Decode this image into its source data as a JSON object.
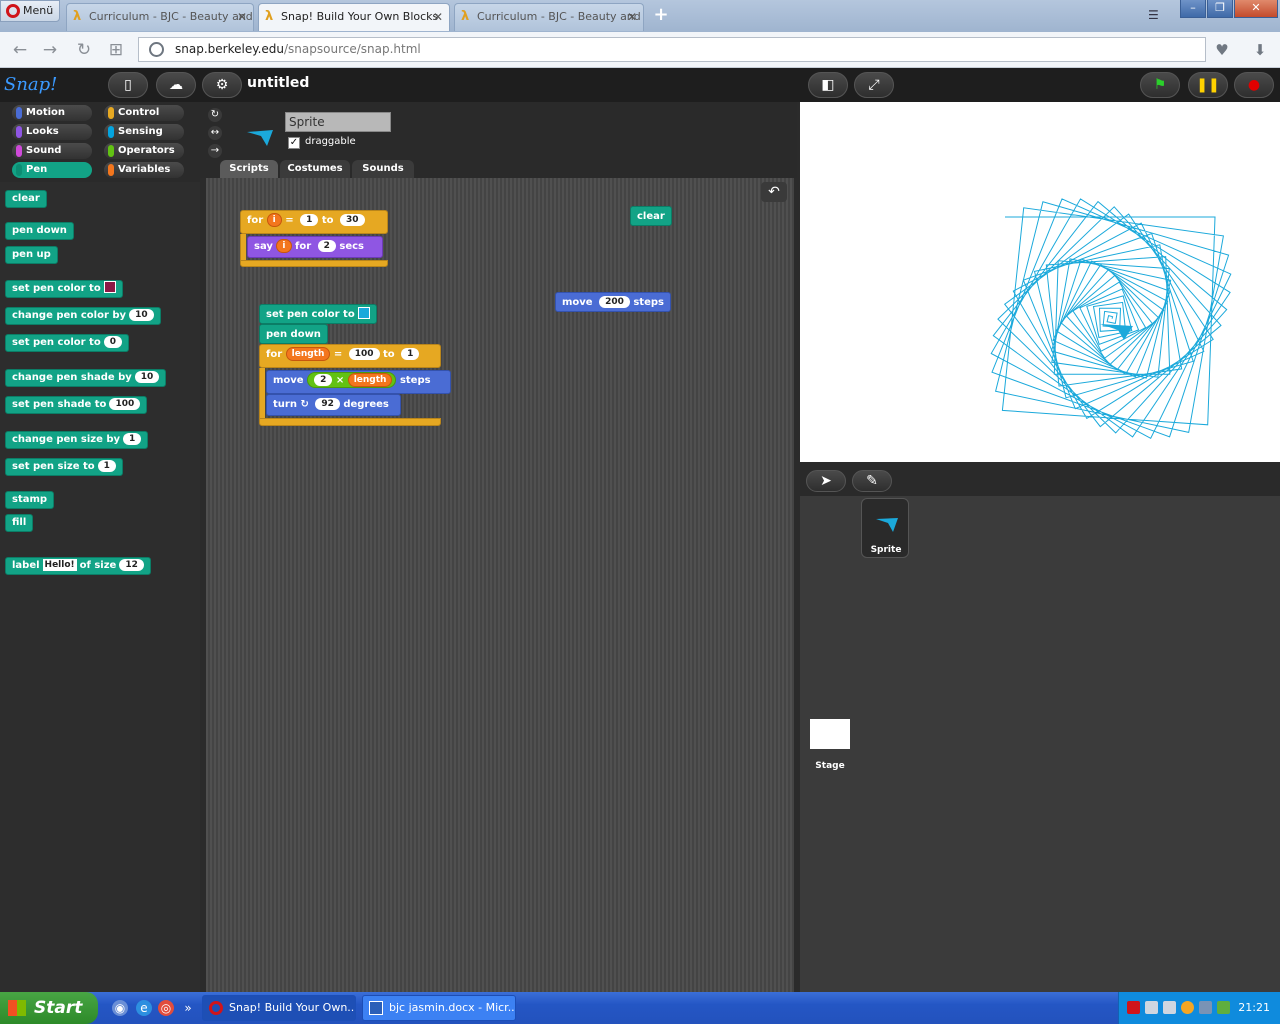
{
  "browser": {
    "menu_label": "Menü",
    "tabs": [
      {
        "title": "Curriculum - BJC - Beauty and Joy of Computing"
      },
      {
        "title": "Snap! Build Your Own Blocks"
      },
      {
        "title": "Curriculum - BJC - Beauty and Joy of Computing"
      }
    ],
    "url_domain": "snap.berkeley.edu",
    "url_path": "/snapsource/snap.html"
  },
  "snap": {
    "logo": "Snap!",
    "project_name": "untitled",
    "categories": [
      "Motion",
      "Control",
      "Looks",
      "Sensing",
      "Sound",
      "Operators",
      "Pen",
      "Variables"
    ],
    "selected_category": "Pen",
    "sprite_name": "Sprite",
    "draggable_label": "draggable",
    "tabs": [
      "Scripts",
      "Costumes",
      "Sounds"
    ],
    "active_tab": "Scripts",
    "palette": {
      "clear": "clear",
      "pen_down": "pen down",
      "pen_up": "pen up",
      "set_pen_color_to": "set pen color to",
      "change_pen_color_by": "change pen color by",
      "change_pen_color_by_val": "10",
      "set_pen_color_to_num": "set pen color to",
      "set_pen_color_to_num_val": "0",
      "change_pen_shade_by": "change pen shade by",
      "change_pen_shade_by_val": "10",
      "set_pen_shade_to": "set pen shade to",
      "set_pen_shade_to_val": "100",
      "change_pen_size_by": "change pen size by",
      "change_pen_size_by_val": "1",
      "set_pen_size_to": "set pen size to",
      "set_pen_size_to_val": "1",
      "stamp": "stamp",
      "fill": "fill",
      "label_pre": "label",
      "label_text": "Hello!",
      "label_of_size": "of size",
      "label_size": "12"
    },
    "script1": {
      "for": "for",
      "var": "i",
      "eq": "=",
      "from": "1",
      "to": "to",
      "to_val": "30",
      "say": "say",
      "say_var": "i",
      "for2": "for",
      "secs_val": "2",
      "secs": "secs"
    },
    "script_clear": "clear",
    "script_move": {
      "move": "move",
      "val": "200",
      "steps": "steps"
    },
    "script2": {
      "set_color": "set pen color to",
      "pen_down": "pen down",
      "for": "for",
      "var": "length",
      "eq": "=",
      "from": "100",
      "to": "to",
      "to_val": "1",
      "move": "move",
      "mult_a": "2",
      "times": "×",
      "mult_b": "length",
      "steps": "steps",
      "turn": "turn",
      "turn_val": "92",
      "degrees": "degrees"
    },
    "corral": {
      "sprite_label": "Sprite",
      "stage_label": "Stage"
    },
    "colors": {
      "pen_block": "#12a386",
      "control_block": "#e6a822",
      "motion_block": "#4a6cd4",
      "looks_block": "#8f56e3",
      "stage_drawing": "#1ba9db",
      "palette_swatch": "#8b1845",
      "script_swatch": "#1ba9db"
    }
  },
  "taskbar": {
    "start": "Start",
    "items": [
      "Snap! Build Your Own...",
      "bjc jasmin.docx - Micr..."
    ],
    "clock": "21:21"
  }
}
